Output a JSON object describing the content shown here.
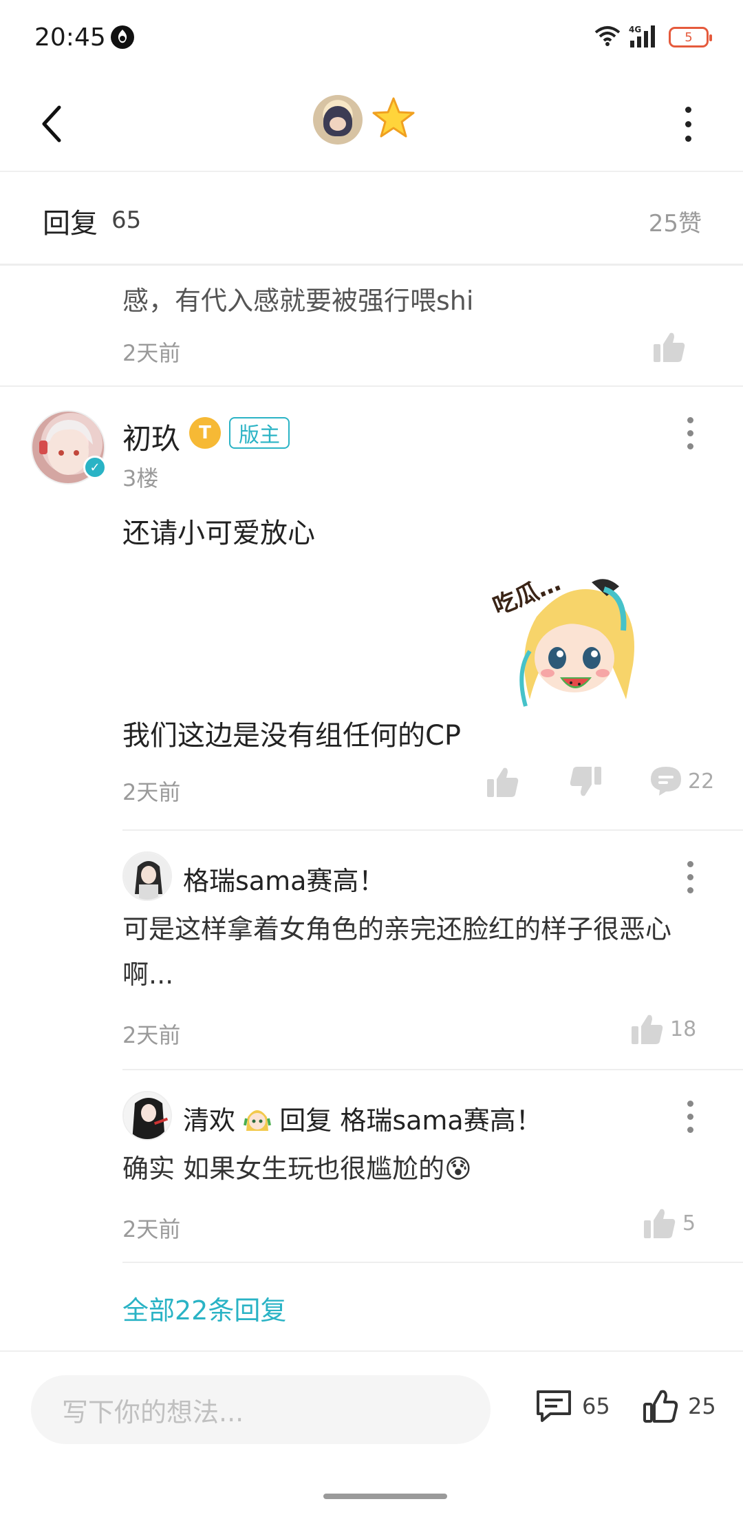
{
  "status_bar": {
    "time": "20:45",
    "network": "4G",
    "battery": "5",
    "icons": [
      "app-notification-icon",
      "wifi-icon",
      "signal-icon",
      "battery-icon"
    ]
  },
  "nav": {
    "back_icon": "chevron-left-icon",
    "badge_icon": "star-icon",
    "more_icon": "vertical-dots-icon"
  },
  "reply_header": {
    "title": "回复",
    "count": "65",
    "likes": "25赞"
  },
  "previous_comment": {
    "text": "感，有代入感就要被强行喂shi",
    "time": "2天前"
  },
  "main_comment": {
    "author": "初玖",
    "level_badge": "T",
    "role_badge": "版主",
    "floor": "3楼",
    "line1": "还请小可爱放心",
    "line2": "我们这边是没有组任何的CP",
    "sticker_text": "吃瓜…",
    "time": "2天前",
    "reply_count": "22"
  },
  "replies": [
    {
      "name": "格瑞sama赛高！",
      "text": "可是这样拿着女角色的亲完还脸红的样子很恶心啊...",
      "time": "2天前",
      "likes": "18"
    },
    {
      "name": "清欢",
      "reply_label": "回复",
      "reply_to": "格瑞sama赛高！",
      "text": "确实 如果女生玩也很尴尬的😰",
      "time": "2天前",
      "likes": "5"
    }
  ],
  "all_replies_link": "全部22条回复",
  "bottom_bar": {
    "input_placeholder": "写下你的想法...",
    "comment_count": "65",
    "like_count": "25"
  },
  "colors": {
    "accent": "#2ab3c5",
    "level_badge": "#f6b935",
    "battery": "#e55a3c",
    "muted_text": "#9a9a9a"
  }
}
